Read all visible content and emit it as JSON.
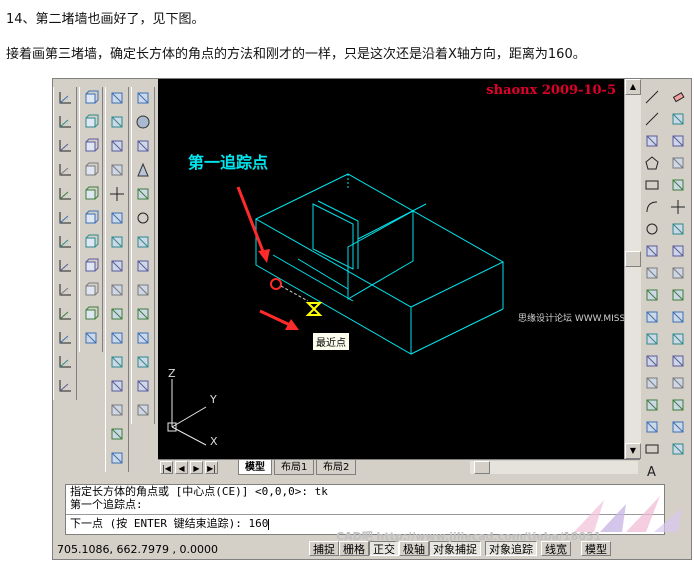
{
  "intro": {
    "step": "14、第二堵墙也画好了，见下图。",
    "instruction": "接着画第三堵墙，确定长方体的角点的方法和刚才的一样，只是这次还是沿着X轴方向，距离为160。"
  },
  "viewport": {
    "signature": "shaonx 2009-10-5",
    "callout": "第一追踪点",
    "tooltip": "最近点",
    "watermark": "思缘设计论坛 WWW.MISSYUAN.COM",
    "axis_z": "Z",
    "axis_y": "Y",
    "axis_x": "X",
    "wire_color": "#00e5ee"
  },
  "layout_tabs": [
    {
      "label": "模型",
      "active": true
    },
    {
      "label": "布局1",
      "active": false
    },
    {
      "label": "布局2",
      "active": false
    }
  ],
  "command_line": {
    "line1": "指定长方体的角点或 [中心点(CE)] <0,0,0>: tk",
    "line2": "第一个追踪点:",
    "line3": "下一点 (按 ENTER 键结束追踪): 160"
  },
  "status": {
    "coords": "705.1086,  662.7979 , 0.0000",
    "snap": "捕捉",
    "grid": "栅格",
    "ortho": "正交",
    "polar": "极轴",
    "osnap": "对象捕捉",
    "otrack": "对象追踪",
    "lwt": "线宽",
    "model": "模型"
  },
  "site_watermark": "CAD吧 http://www.jiliecad.com/tieba/18051",
  "icons": {
    "left_column_1": [
      "ucs-icon",
      "ucs-world-icon",
      "ucs-prev-icon",
      "ucs-object-icon",
      "ucs-face-icon",
      "ucs-view-icon",
      "ucs-origin-icon",
      "ucs-zaxis-icon",
      "ucs-3point-icon",
      "ucs-x-icon",
      "ucs-y-icon",
      "ucs-z-icon",
      "ucs-apply-icon"
    ],
    "left_column_2": [
      "view-top-icon",
      "view-bottom-icon",
      "view-left-icon",
      "view-right-icon",
      "view-front-icon",
      "view-back-icon",
      "iso-sw-icon",
      "iso-se-icon",
      "iso-ne-icon",
      "iso-nw-icon",
      "camera-icon"
    ],
    "left_column_3": [
      "union-icon",
      "subtract-icon",
      "intersect-icon",
      "extrude-faces-icon",
      "move-faces-icon",
      "offset-faces-icon",
      "delete-faces-icon",
      "rotate-faces-icon",
      "taper-faces-icon",
      "copy-faces-icon",
      "color-faces-icon",
      "imprint-icon",
      "clean-icon",
      "separate-icon",
      "shell-icon",
      "check-icon"
    ],
    "left_column_4": [
      "box-icon",
      "sphere-icon",
      "cylinder-icon",
      "cone-icon",
      "wedge-icon",
      "torus-icon",
      "extrude-icon",
      "revolve-icon",
      "slice-icon",
      "section-icon",
      "interfere-icon",
      "setup-drawing-icon",
      "setup-view-icon",
      "setup-profile-icon"
    ],
    "right_column_1": [
      "line-icon",
      "construction-line-icon",
      "polyline-icon",
      "polygon-icon",
      "rectangle-icon",
      "arc-icon",
      "circle-icon",
      "revision-cloud-icon",
      "spline-icon",
      "ellipse-icon",
      "ellipse-arc-icon",
      "insert-block-icon",
      "make-block-icon",
      "point-icon",
      "hatch-icon",
      "region-icon",
      "table-icon",
      "multiline-text-icon"
    ],
    "right_column_2": [
      "erase-icon",
      "copy-icon",
      "mirror-icon",
      "offset-icon",
      "array-icon",
      "move-icon",
      "rotate-icon",
      "scale-icon",
      "stretch-icon",
      "trim-icon",
      "extend-icon",
      "break-point-icon",
      "break-icon",
      "join-icon",
      "chamfer-icon",
      "fillet-icon",
      "explode-icon"
    ]
  }
}
